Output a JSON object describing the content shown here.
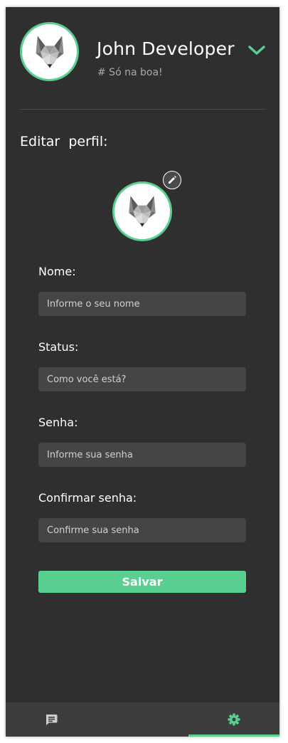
{
  "header": {
    "user_name": "John Developer",
    "user_status": "# Só na boa!"
  },
  "edit_profile": {
    "title": "Editar  perfil:",
    "fields": [
      {
        "label": "Nome:",
        "placeholder": "Informe o seu nome",
        "value": ""
      },
      {
        "label": "Status:",
        "placeholder": "Como você está?",
        "value": ""
      },
      {
        "label": "Senha:",
        "placeholder": "Informe sua senha",
        "value": ""
      },
      {
        "label": "Confirmar senha:",
        "placeholder": "Confirme sua senha",
        "value": ""
      }
    ],
    "save_label": "Salvar"
  },
  "bottom_nav": {
    "tabs": [
      {
        "icon": "chat-icon",
        "active": false
      },
      {
        "icon": "gear-icon",
        "active": true
      }
    ]
  },
  "colors": {
    "accent": "#59cf90",
    "panel_background": "#2f2f2f",
    "input_background": "#454545",
    "nav_background": "#3d3d3d"
  }
}
